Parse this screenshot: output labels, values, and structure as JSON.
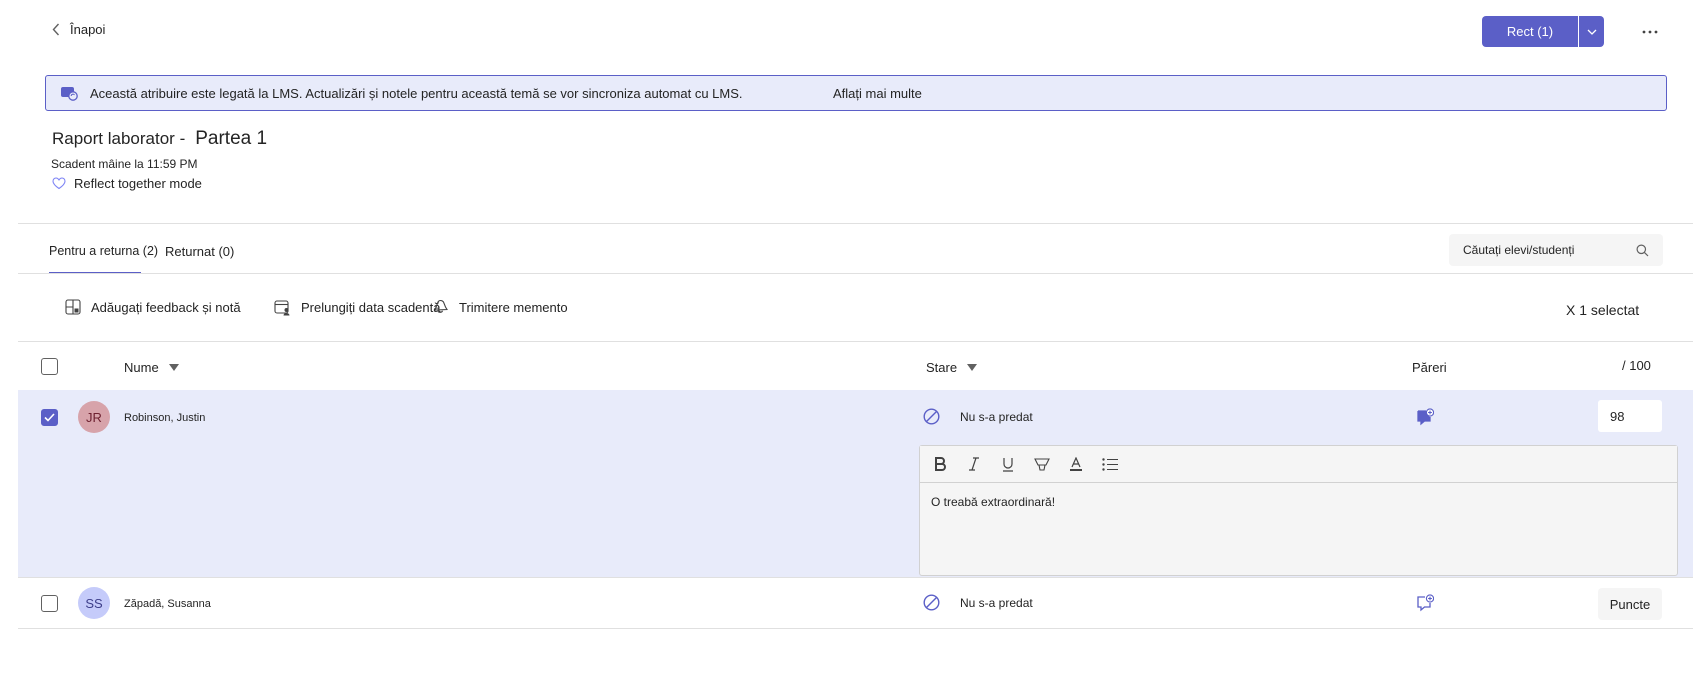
{
  "topbar": {
    "back_label": "Înapoi",
    "return_button_label": "Rect (1)",
    "more_label": "..."
  },
  "banner": {
    "text": "Această atribuire este legată la LMS. Actualizări și notele pentru această temă se vor sincroniza automat cu LMS.",
    "link_label": "Aflați mai multe"
  },
  "assignment": {
    "title_part1": "Raport laborator -",
    "title_part2": "Partea 1",
    "due": "Scadent mâine la 11:59 PM",
    "mode": "Reflect together mode"
  },
  "tabs": [
    {
      "label": "Pentru a returna (2)",
      "active": true
    },
    {
      "label": "Returnat (0)",
      "active": false
    }
  ],
  "search": {
    "placeholder": "Căutați elevi/studenți"
  },
  "toolbar": {
    "feedback_label": "Adăugați feedback și notă",
    "extend_label": "Prelungiți data scadentă",
    "reminder_label": "Trimitere memento",
    "selected_label": "X 1 selectat"
  },
  "table": {
    "headers": {
      "name": "Nume",
      "status": "Stare",
      "feedback": "Păreri",
      "points": "/ 100"
    },
    "rows": [
      {
        "initials": "JR",
        "name": "Robinson, Justin",
        "status": "Nu s-a predat",
        "grade": "98",
        "checked": true,
        "feedback_text": "O treabă extraordinară!"
      },
      {
        "initials": "SS",
        "name": "Zăpadă, Susanna",
        "status": "Nu s-a predat",
        "grade_button": "Puncte",
        "checked": false
      }
    ]
  },
  "colors": {
    "accent": "#5b5fc7",
    "selected_row": "#e8ebfa",
    "avatar_jr": "#d7a3aa",
    "avatar_ss": "#c5cbfa"
  }
}
